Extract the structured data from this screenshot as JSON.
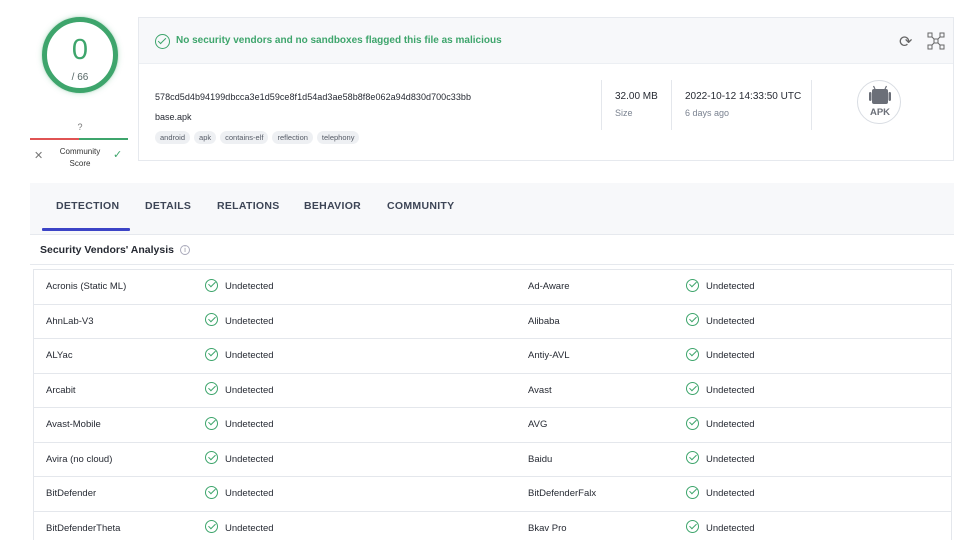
{
  "score": {
    "detections": "0",
    "total": "/ 66"
  },
  "community": {
    "value": "?",
    "label": "Community Score",
    "label_line1": "Community",
    "label_line2": "Score"
  },
  "banner": {
    "message": "No security vendors and no sandboxes flagged this file as malicious"
  },
  "file": {
    "hash": "578cd5d4b94199dbcca3e1d59ce8f1d54ad3ae58b8f8e062a94d830d700c33bb",
    "name": "base.apk",
    "tags": [
      "android",
      "apk",
      "contains-elf",
      "reflection",
      "telephony"
    ],
    "size_value": "32.00 MB",
    "size_label": "Size",
    "date_value": "2022-10-12 14:33:50 UTC",
    "date_label": "6 days ago",
    "type_icon_text": "APK"
  },
  "tabs": [
    "DETECTION",
    "DETAILS",
    "RELATIONS",
    "BEHAVIOR",
    "COMMUNITY"
  ],
  "active_tab": "DETECTION",
  "section": {
    "title": "Security Vendors' Analysis"
  },
  "vendors": [
    {
      "left": "Acronis (Static ML)",
      "left_result": "Undetected",
      "right": "Ad-Aware",
      "right_result": "Undetected"
    },
    {
      "left": "AhnLab-V3",
      "left_result": "Undetected",
      "right": "Alibaba",
      "right_result": "Undetected"
    },
    {
      "left": "ALYac",
      "left_result": "Undetected",
      "right": "Antiy-AVL",
      "right_result": "Undetected"
    },
    {
      "left": "Arcabit",
      "left_result": "Undetected",
      "right": "Avast",
      "right_result": "Undetected"
    },
    {
      "left": "Avast-Mobile",
      "left_result": "Undetected",
      "right": "AVG",
      "right_result": "Undetected"
    },
    {
      "left": "Avira (no cloud)",
      "left_result": "Undetected",
      "right": "Baidu",
      "right_result": "Undetected"
    },
    {
      "left": "BitDefender",
      "left_result": "Undetected",
      "right": "BitDefenderFalx",
      "right_result": "Undetected"
    },
    {
      "left": "BitDefenderTheta",
      "left_result": "Undetected",
      "right": "Bkav Pro",
      "right_result": "Undetected"
    }
  ],
  "colors": {
    "clean": "#3ea56c",
    "malicious": "#e05353",
    "tab_accent": "#3c44c6"
  },
  "icons": {
    "refresh": "refresh-icon",
    "graph": "graph-icon",
    "info": "info-icon",
    "check": "check-circle-icon",
    "file_type": "android-apk-icon"
  }
}
